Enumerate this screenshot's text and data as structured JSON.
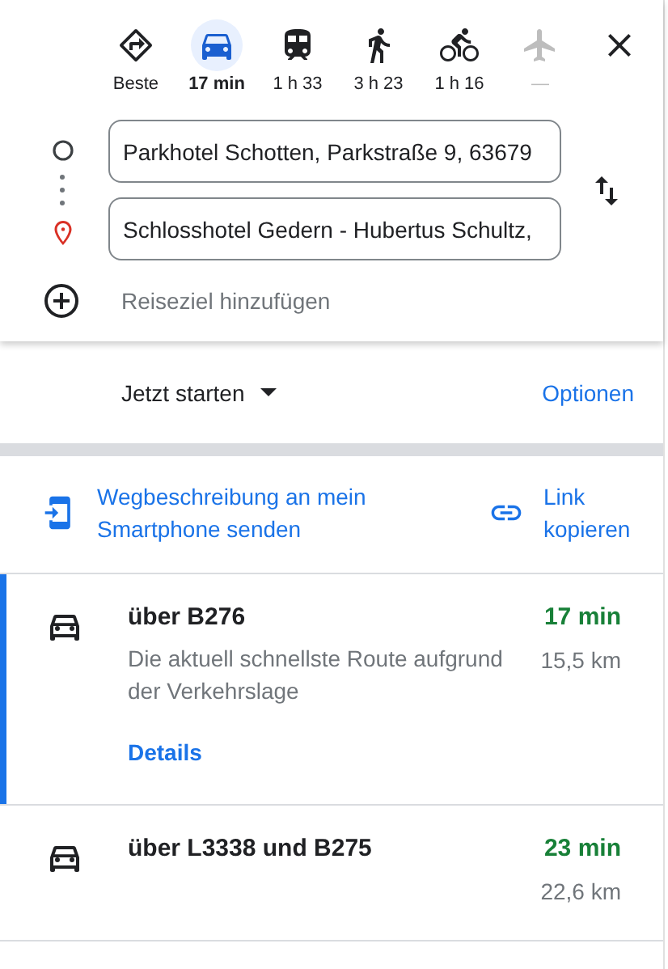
{
  "modes": [
    {
      "kind": "best",
      "label": "Beste",
      "selected": false,
      "disabled": false
    },
    {
      "kind": "car",
      "label": "17 min",
      "selected": true,
      "disabled": false
    },
    {
      "kind": "transit",
      "label": "1 h 33",
      "selected": false,
      "disabled": false
    },
    {
      "kind": "walk",
      "label": "3 h 23",
      "selected": false,
      "disabled": false
    },
    {
      "kind": "bike",
      "label": "1 h 16",
      "selected": false,
      "disabled": false
    },
    {
      "kind": "flight",
      "label": "—",
      "selected": false,
      "disabled": true
    }
  ],
  "origin": {
    "value": "Parkhotel Schotten, Parkstraße 9, 63679"
  },
  "destination": {
    "value": "Schlosshotel Gedern - Hubertus Schultz,"
  },
  "add_destination": "Reiseziel hinzufügen",
  "depart": "Jetzt starten",
  "options_link": "Optionen",
  "share": [
    {
      "kind": "send",
      "label": "Wegbeschreibung an mein Smartphone senden"
    },
    {
      "kind": "link",
      "label": "Link kopieren"
    }
  ],
  "routes": [
    {
      "name": "über B276",
      "duration": "17 min",
      "distance": "15,5 km",
      "description": "Die aktuell schnellste Route aufgrund der Verkehrslage",
      "details_link": "Details",
      "selected": true
    },
    {
      "name": "über L3338 und B275",
      "duration": "23 min",
      "distance": "22,6 km",
      "selected": false
    }
  ]
}
